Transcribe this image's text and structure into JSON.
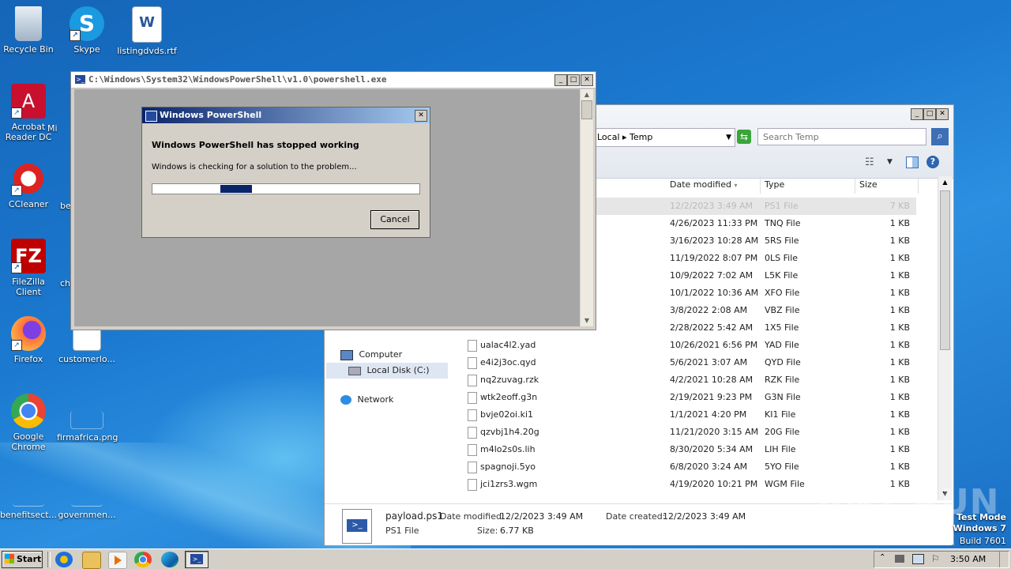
{
  "desktop": {
    "icons": [
      {
        "label": "Recycle Bin"
      },
      {
        "label": "Skype"
      },
      {
        "label": "listingdvds.rtf"
      },
      {
        "label": "Acrobat Reader DC"
      },
      {
        "label": "Mi"
      },
      {
        "label": "CCleaner"
      },
      {
        "label": "be"
      },
      {
        "label": "FileZilla Client"
      },
      {
        "label": "ch"
      },
      {
        "label": "Firefox"
      },
      {
        "label": "customerlo..."
      },
      {
        "label": "Google Chrome"
      },
      {
        "label": "firmafrica.png"
      },
      {
        "label": "benefitsect..."
      },
      {
        "label": "governmen..."
      }
    ]
  },
  "powershell_window": {
    "title": "C:\\Windows\\System32\\WindowsPowerShell\\v1.0\\powershell.exe"
  },
  "error_dialog": {
    "title": "Windows PowerShell",
    "heading": "Windows PowerShell has stopped working",
    "message": "Windows is checking for a solution to the problem...",
    "cancel_label": "Cancel",
    "progress_fraction": 0.35
  },
  "explorer": {
    "breadcrumb": [
      "Local",
      "Temp"
    ],
    "search_placeholder": "Search Temp",
    "columns": [
      "Date modified",
      "Type",
      "Size"
    ],
    "nav": [
      {
        "label": "Computer"
      },
      {
        "label": "Local Disk (C:)"
      },
      {
        "label": "Network"
      }
    ],
    "files": [
      {
        "name": "",
        "date": "12/2/2023 3:49 AM",
        "type": "PS1 File",
        "size": "7 KB"
      },
      {
        "name": "",
        "date": "4/26/2023 11:33 PM",
        "type": "TNQ File",
        "size": "1 KB"
      },
      {
        "name": "",
        "date": "3/16/2023 10:28 AM",
        "type": "5RS File",
        "size": "1 KB"
      },
      {
        "name": "",
        "date": "11/19/2022 8:07 PM",
        "type": "0LS File",
        "size": "1 KB"
      },
      {
        "name": "",
        "date": "10/9/2022 7:02 AM",
        "type": "L5K File",
        "size": "1 KB"
      },
      {
        "name": "",
        "date": "10/1/2022 10:36 AM",
        "type": "XFO File",
        "size": "1 KB"
      },
      {
        "name": "",
        "date": "3/8/2022 2:08 AM",
        "type": "VBZ File",
        "size": "1 KB"
      },
      {
        "name": "",
        "date": "2/28/2022 5:42 AM",
        "type": "1X5 File",
        "size": "1 KB"
      },
      {
        "name": "ualac4l2.yad",
        "date": "10/26/2021 6:56 PM",
        "type": "YAD File",
        "size": "1 KB"
      },
      {
        "name": "e4i2j3oc.qyd",
        "date": "5/6/2021 3:07 AM",
        "type": "QYD File",
        "size": "1 KB"
      },
      {
        "name": "nq2zuvag.rzk",
        "date": "4/2/2021 10:28 AM",
        "type": "RZK File",
        "size": "1 KB"
      },
      {
        "name": "wtk2eoff.g3n",
        "date": "2/19/2021 9:23 PM",
        "type": "G3N File",
        "size": "1 KB"
      },
      {
        "name": "bvje02oi.ki1",
        "date": "1/1/2021 4:20 PM",
        "type": "KI1 File",
        "size": "1 KB"
      },
      {
        "name": "qzvbj1h4.20g",
        "date": "11/21/2020 3:15 AM",
        "type": "20G File",
        "size": "1 KB"
      },
      {
        "name": "m4lo2s0s.lih",
        "date": "8/30/2020 5:34 AM",
        "type": "LIH File",
        "size": "1 KB"
      },
      {
        "name": "spagnoji.5yo",
        "date": "6/8/2020 3:24 AM",
        "type": "5YO File",
        "size": "1 KB"
      },
      {
        "name": "jci1zrs3.wgm",
        "date": "4/19/2020 10:21 PM",
        "type": "WGM File",
        "size": "1 KB"
      }
    ],
    "details": {
      "filename": "payload.ps1",
      "filetype": "PS1 File",
      "modified_label": "Date modified:",
      "modified_value": "12/2/2023 3:49 AM",
      "size_label": "Size:",
      "size_value": "6.77 KB",
      "created_label": "Date created:",
      "created_value": "12/2/2023 3:49 AM"
    }
  },
  "taskbar": {
    "start_label": "Start",
    "clock": "3:50 AM"
  },
  "watermark": {
    "text": "ANY RUN",
    "mode_line": "Test Mode",
    "os_line": "Windows 7",
    "build_line": "Build 7601"
  }
}
